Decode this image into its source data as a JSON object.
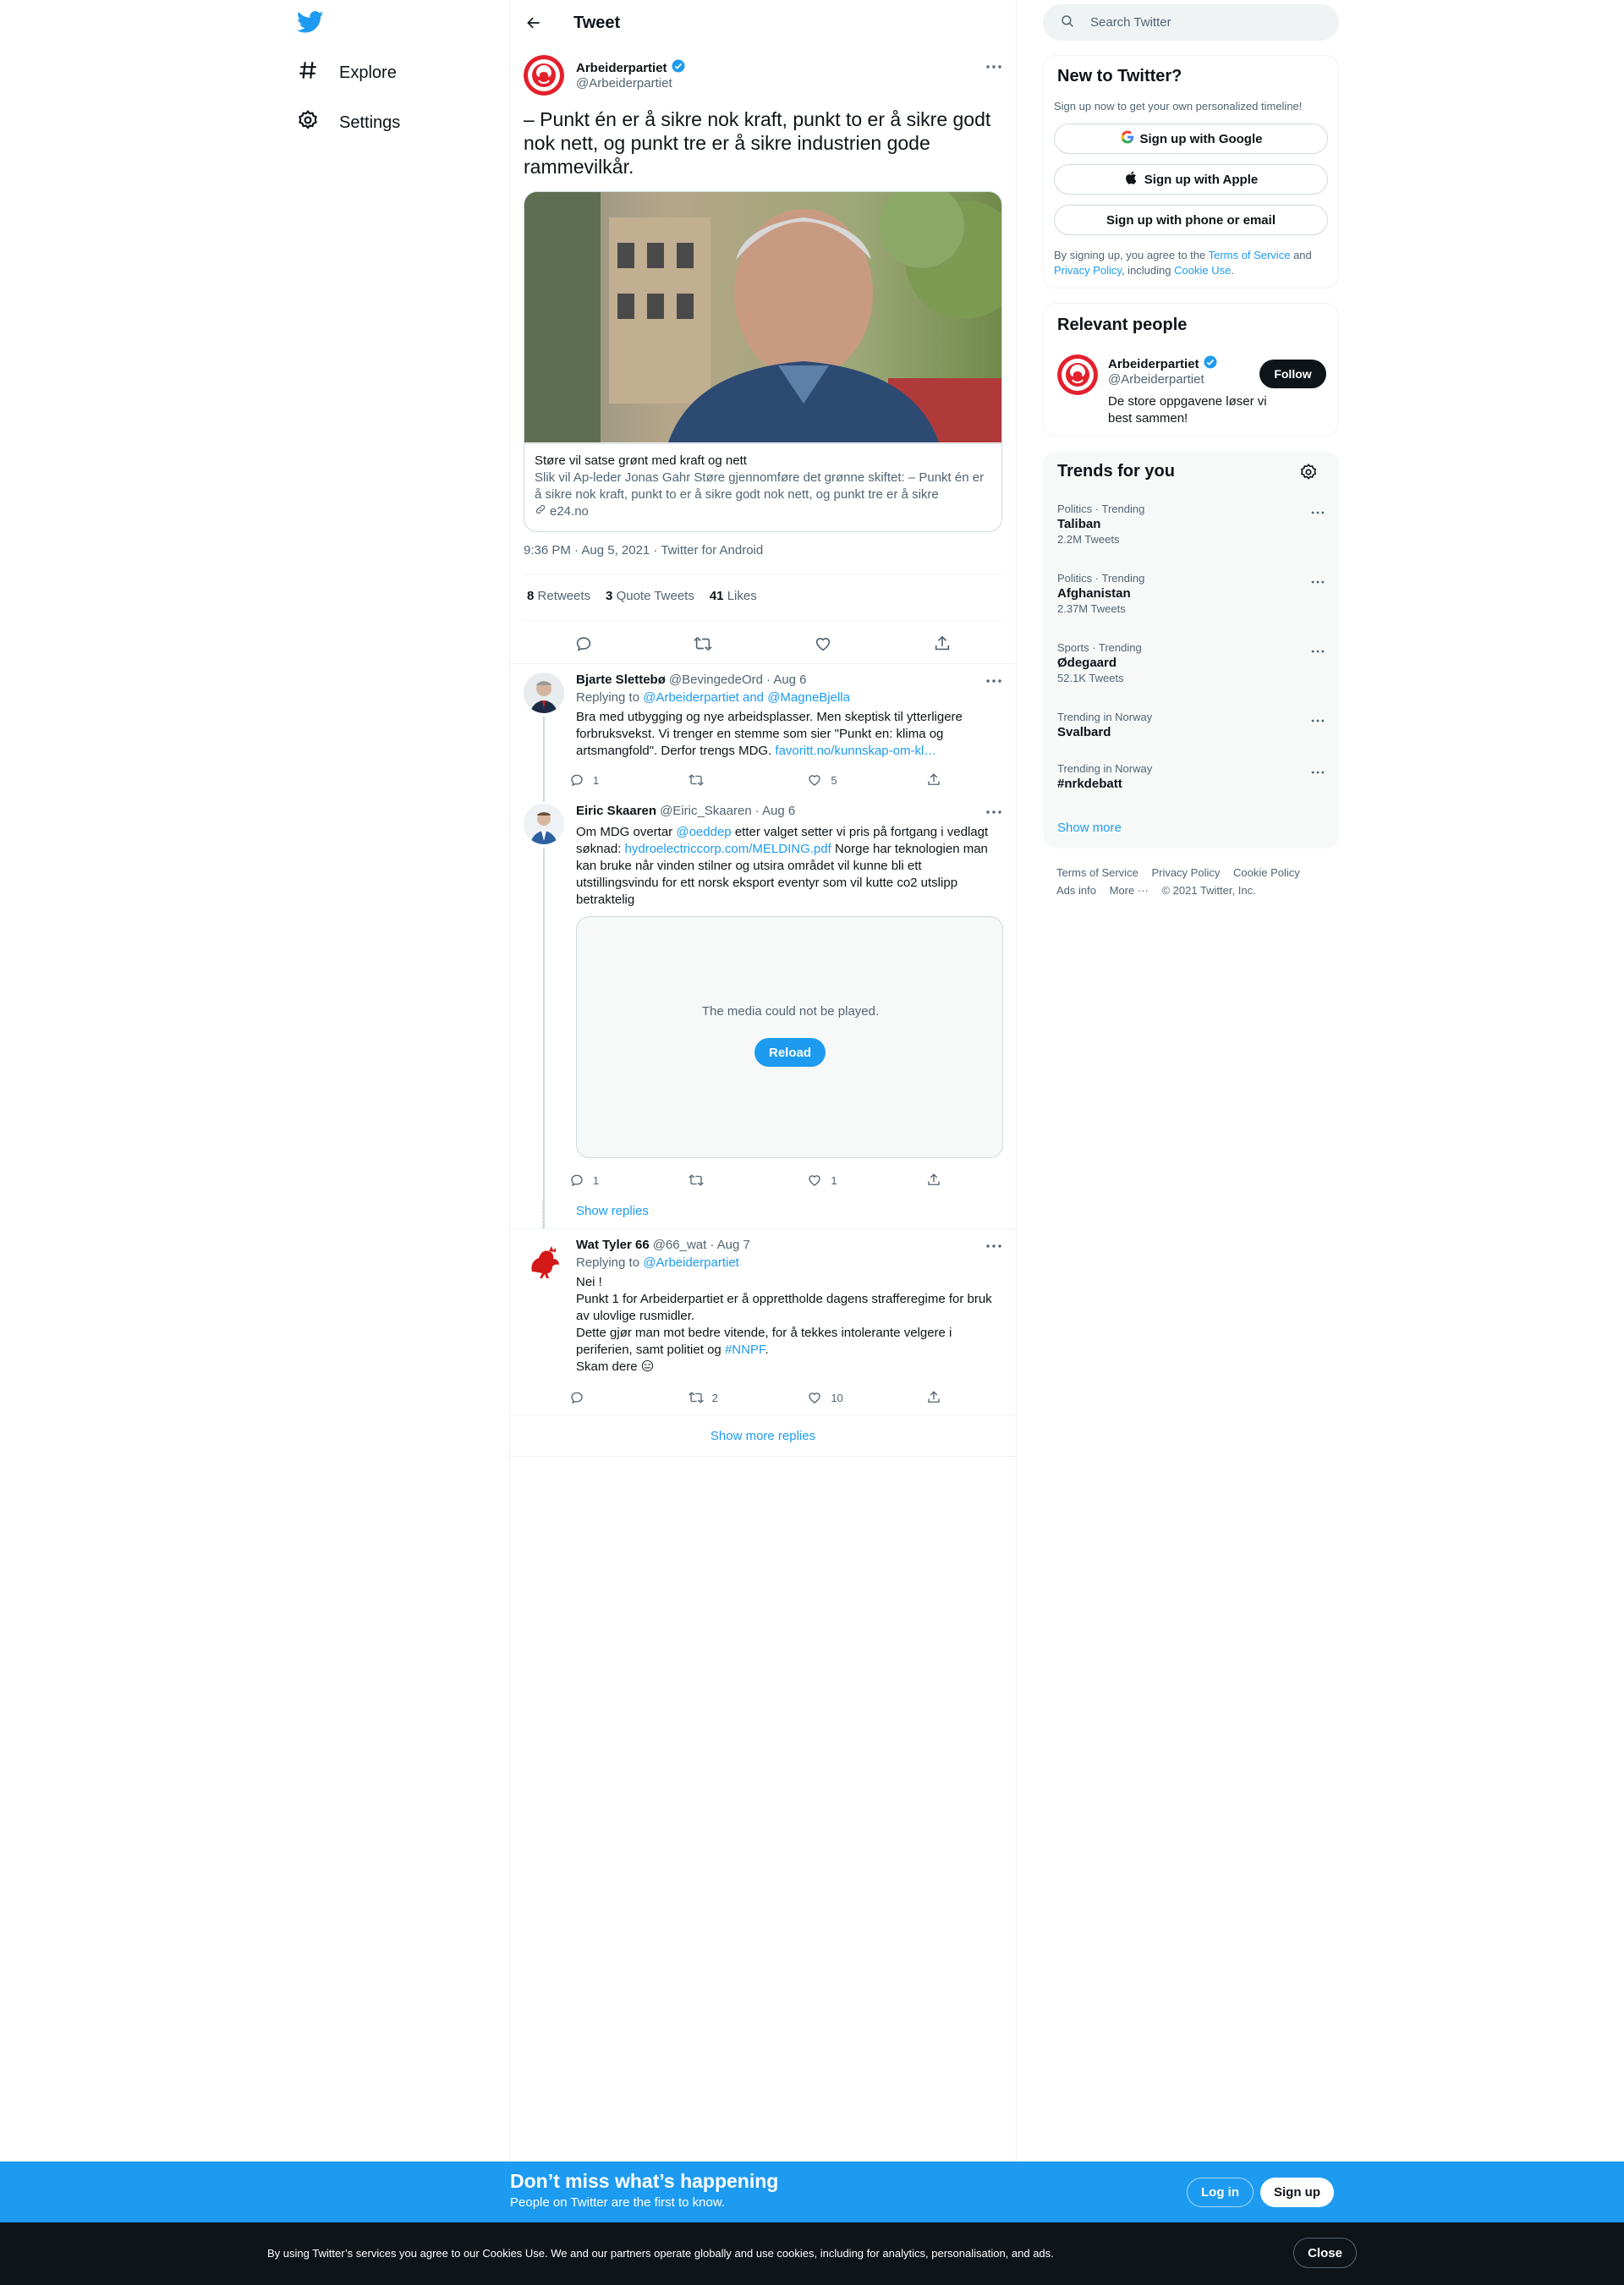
{
  "nav": {
    "explore_label": "Explore",
    "settings_label": "Settings"
  },
  "header": {
    "title": "Tweet"
  },
  "main_tweet": {
    "author_name": "Arbeiderpartiet",
    "author_handle": "@Arbeiderpartiet",
    "text": "– Punkt én er å sikre nok kraft, punkt to er å sikre godt nok nett, og punkt tre er å sikre industrien gode rammevilkår.",
    "card": {
      "title": "Støre vil satse grønt med kraft og nett",
      "description": "Slik vil Ap-leder Jonas Gahr Støre gjennomføre det grønne skiftet: – Punkt én er å sikre nok kraft, punkt to er å sikre godt nok nett, og punkt tre er å sikre industri…",
      "domain": "e24.no"
    },
    "meta": "9:36 PM · Aug 5, 2021 · Twitter for Android",
    "stats": {
      "retweets_count": "8",
      "retweets_label": "Retweets",
      "quotes_count": "3",
      "quotes_label": "Quote Tweets",
      "likes_count": "41",
      "likes_label": "Likes"
    }
  },
  "replies": [
    {
      "name": "Bjarte Slettebø",
      "handle": "@BevingedeOrd",
      "date": "· Aug 6",
      "replying_label": "Replying to",
      "replying_to": "@Arbeiderpartiet and @MagneBjella",
      "text": "Bra med utbygging og nye arbeidsplasser. Men skeptisk til ytterligere forbruksvekst. Vi trenger en stemme som sier \"Punkt en: klima og artsmangfold\". Derfor trengs MDG.",
      "link": "favoritt.no/kunnskap-om-kl…",
      "reply_count": "1",
      "retweet_count": "",
      "like_count": "5"
    },
    {
      "name": "Eiric Skaaren",
      "handle": "@Eiric_Skaaren",
      "date": "· Aug 6",
      "text_a": "Om MDG overtar",
      "mention": "@oeddep",
      "text_b": "etter valget setter vi pris på fortgang i vedlagt søknad:",
      "link": "hydroelectriccorp.com/MELDING.pdf",
      "text_c": "Norge har teknologien man kan bruke når vinden stilner og utsira området vil kunne bli ett utstillingsvindu for ett norsk eksport eventyr som vil kutte co2 utslipp betraktelig",
      "media_error": "The media could not be played.",
      "reload_label": "Reload",
      "reply_count": "1",
      "retweet_count": "",
      "like_count": "1",
      "show_replies": "Show replies"
    },
    {
      "name": "Wat Tyler 66",
      "handle": "@66_wat",
      "date": "· Aug 7",
      "replying_label": "Replying to",
      "replying_to": "@Arbeiderpartiet",
      "line1": "Nei !",
      "line2": "Punkt 1 for Arbeiderpartiet er å opprettholde dagens strafferegime for bruk av ulovlige rusmidler.",
      "line3a": "Dette gjør man mot bedre vitende, for å tekkes intolerante velgere i periferien, samt politiet og",
      "hashtag": "#NNPF",
      "line3b": ".",
      "line4": "Skam dere 😑",
      "reply_count": "",
      "retweet_count": "2",
      "like_count": "10"
    }
  ],
  "show_more_replies": "Show more replies",
  "search": {
    "placeholder": "Search Twitter"
  },
  "new_to_twitter": {
    "title": "New to Twitter?",
    "subtitle": "Sign up now to get your own personalized timeline!",
    "google_label": "Sign up with Google",
    "apple_label": "Sign up with Apple",
    "email_label": "Sign up with phone or email",
    "terms_a": "By signing up, you agree to the",
    "terms_link1": "Terms of Service",
    "terms_b": "and",
    "terms_link2": "Privacy Policy",
    "terms_c": ", including",
    "terms_link3": "Cookie Use",
    "terms_d": "."
  },
  "relevant_people": {
    "title": "Relevant people",
    "name": "Arbeiderpartiet",
    "handle": "@Arbeiderpartiet",
    "bio": "De store oppgavene løser vi best sammen!",
    "follow_label": "Follow"
  },
  "trends": {
    "title": "Trends for you",
    "items": [
      {
        "category": "Politics · Trending",
        "name": "Taliban",
        "count": "2.2M Tweets"
      },
      {
        "category": "Politics · Trending",
        "name": "Afghanistan",
        "count": "2.37M Tweets"
      },
      {
        "category": "Sports · Trending",
        "name": "Ødegaard",
        "count": "52.1K Tweets"
      },
      {
        "category": "Trending in Norway",
        "name": "Svalbard",
        "count": ""
      },
      {
        "category": "Trending in Norway",
        "name": "#nrkdebatt",
        "count": ""
      }
    ],
    "show_more": "Show more"
  },
  "footer": {
    "terms": "Terms of Service",
    "privacy": "Privacy Policy",
    "cookie": "Cookie Policy",
    "ads": "Ads info",
    "more": "More ···",
    "copyright": "© 2021 Twitter, Inc."
  },
  "signup_bar": {
    "title": "Don’t miss what’s happening",
    "subtitle": "People on Twitter are the first to know.",
    "login_label": "Log in",
    "signup_label": "Sign up"
  },
  "cookie_bar": {
    "text": "By using Twitter’s services you agree to our Cookies Use. We and our partners operate globally and use cookies, including for analytics, personalisation, and ads.",
    "close_label": "Close"
  },
  "colors": {
    "accent": "#1d9bf0",
    "text": "#0f1419",
    "muted": "#536471"
  }
}
